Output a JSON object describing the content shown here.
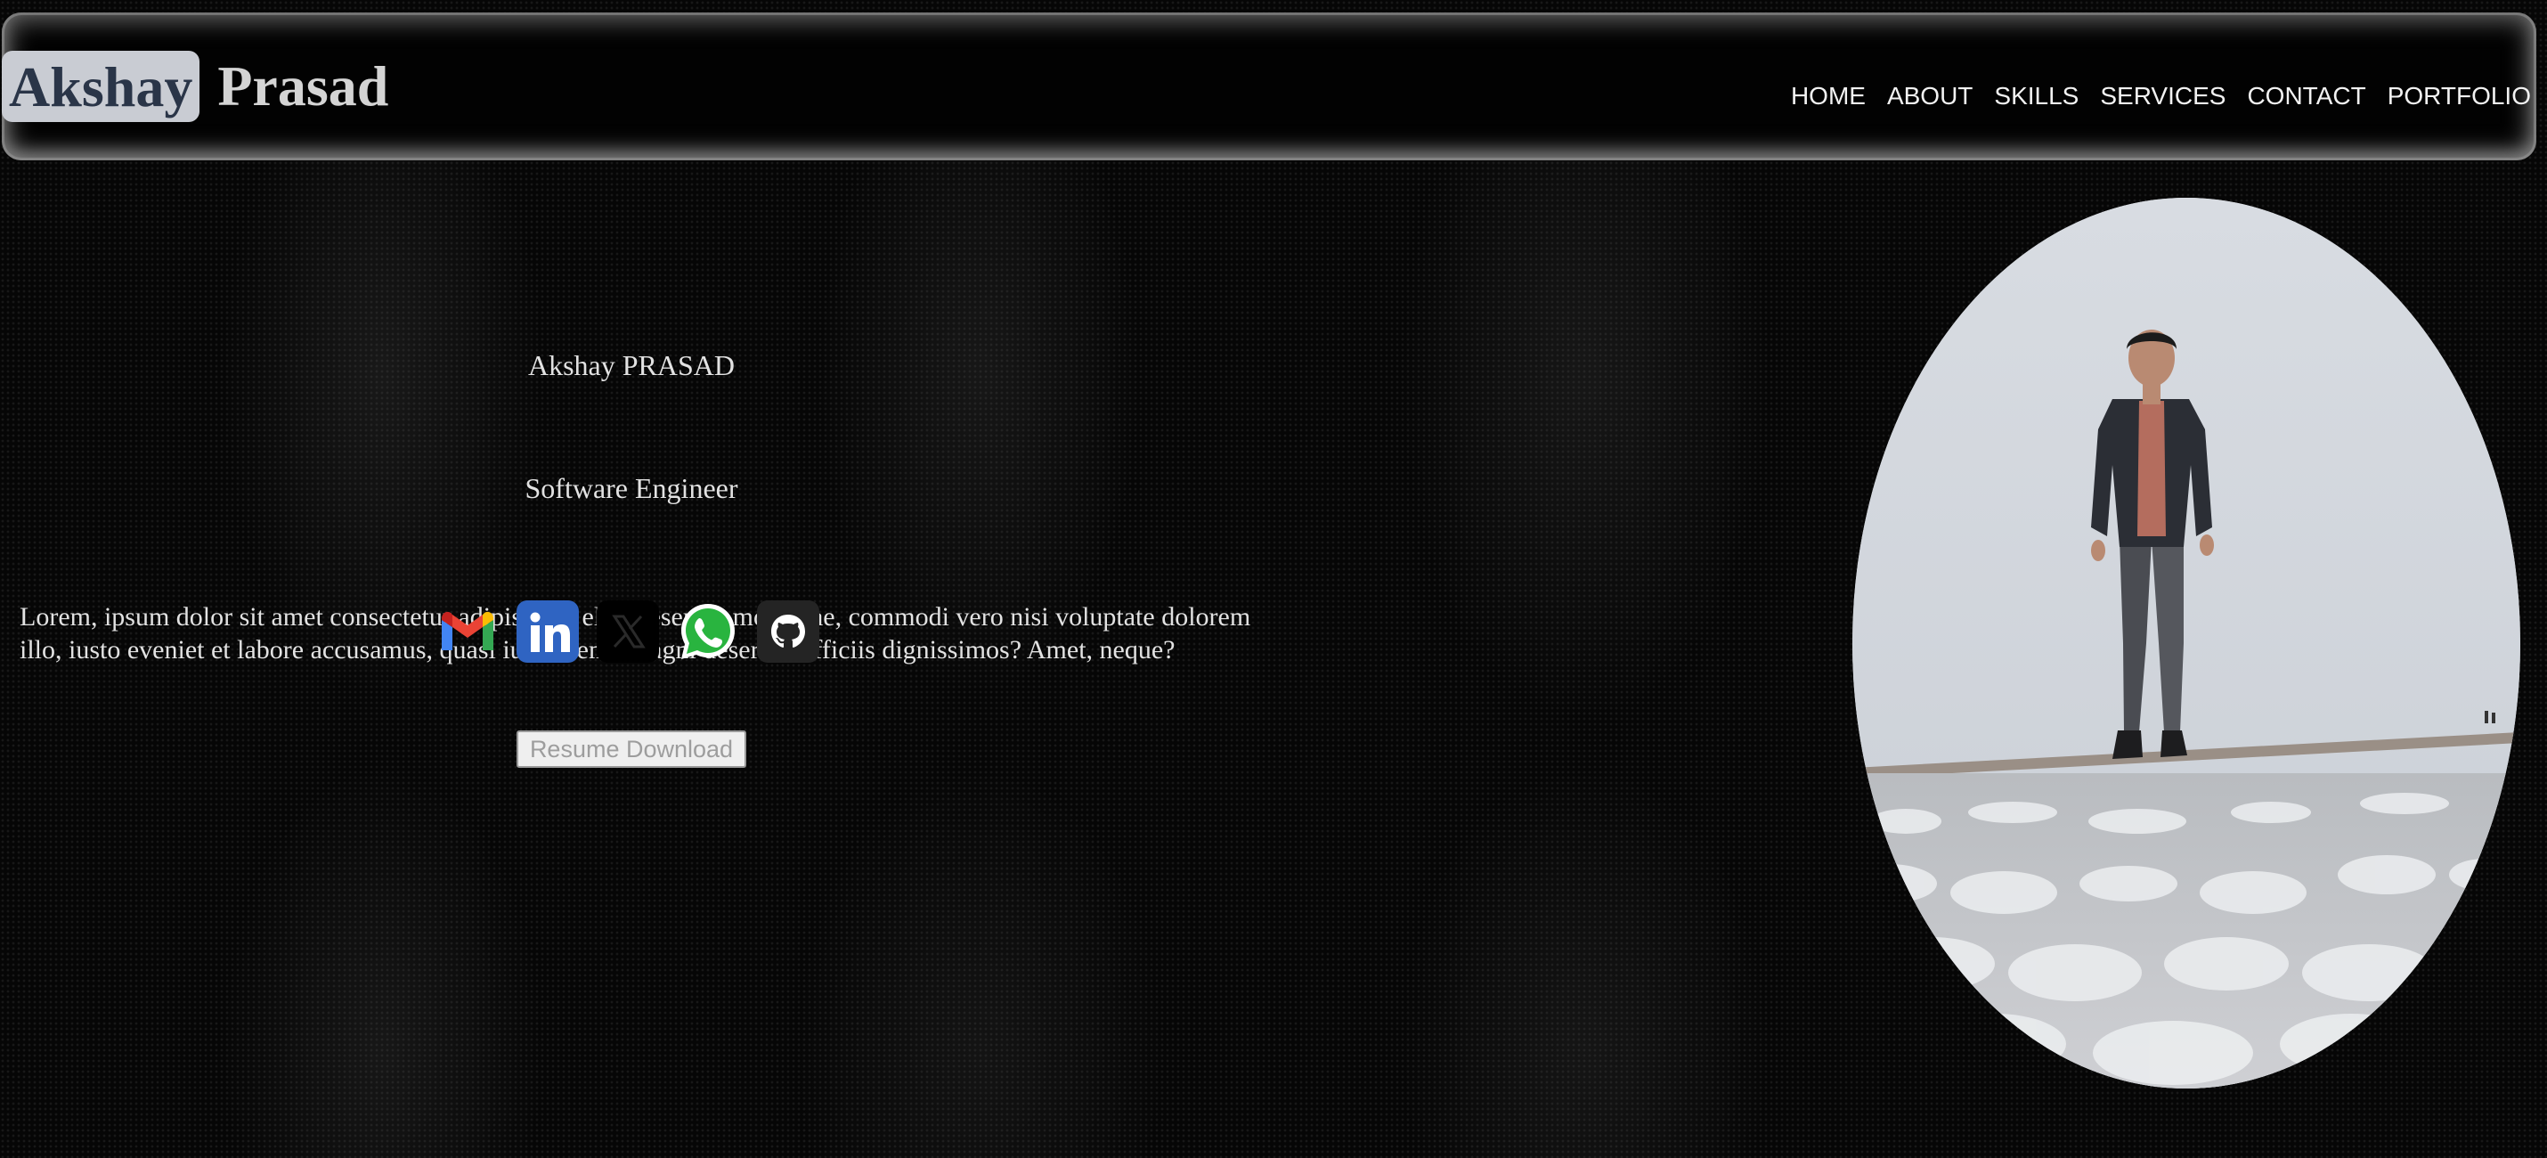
{
  "header": {
    "logo_first": "Akshay",
    "logo_last": "Prasad",
    "nav": [
      "HOME",
      "ABOUT",
      "SKILLS",
      "SERVICES",
      "CONTACT",
      "PORTFOLIO"
    ]
  },
  "hero": {
    "name": "Akshay PRASAD",
    "role": "Software Engineer",
    "description": "Lorem, ipsum dolor sit amet consectetur adipisicing elit. Deserunt molestiae, commodi vero nisi voluptate dolorem illo, iusto eveniet et labore accusamus, quasi iure. Nemo magni deserunt officiis dignissimos? Amet, neque?",
    "resume_button": "Resume Download"
  },
  "social_icons": [
    "gmail-icon",
    "linkedin-icon",
    "x-icon",
    "whatsapp-icon",
    "github-icon"
  ],
  "colors": {
    "background": "#060606",
    "logo_badge_bg": "#c9ccd3",
    "logo_badge_text": "#2a3548",
    "text": "#e2e2e2"
  }
}
